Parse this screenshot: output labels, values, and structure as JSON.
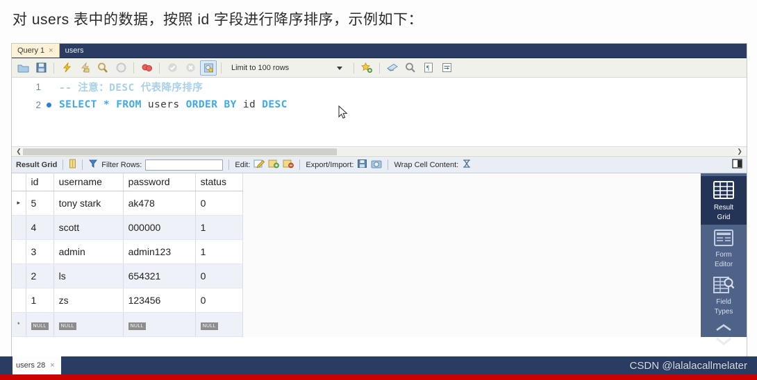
{
  "heading": "对 users 表中的数据，按照 id 字段进行降序排序，示例如下：",
  "tabs": {
    "query_tab": "Query 1",
    "query_tab_close": "×",
    "table_tab": "users"
  },
  "toolbar": {
    "icons": [
      "open-folder-icon",
      "save-icon",
      "execute-icon",
      "execute-current-icon",
      "explain-icon",
      "stop-on-error-icon",
      "toggle-query-icon",
      "commit-icon",
      "rollback-icon",
      "autocommit-icon"
    ],
    "limit_label": "Limit to 100 rows",
    "right_icons": [
      "beautify-icon",
      "find-icon",
      "search-icon",
      "toggle-invisible-icon",
      "wrap-lines-icon"
    ]
  },
  "editor": {
    "lines": [
      {
        "number": "1",
        "marker": "",
        "comment": "-- 注意：DESC 代表降序排序"
      },
      {
        "number": "2",
        "marker": "dot",
        "kw1": "SELECT",
        "star": "*",
        "kw2": "FROM",
        "table": "users",
        "kw3": "ORDER BY",
        "column": "id",
        "kw4": "DESC"
      }
    ]
  },
  "gridbar": {
    "result_grid_label": "Result Grid",
    "grid_icon": "grid-toggle-icon",
    "filter_icon": "filter-icon",
    "filter_rows_label": "Filter Rows:",
    "filter_value": "",
    "filter_placeholder": "",
    "edit_label": "Edit:",
    "edit_icons": [
      "edit-pencil-icon",
      "insert-row-icon",
      "delete-row-icon"
    ],
    "export_label": "Export/Import:",
    "export_icons": [
      "export-icon",
      "import-icon"
    ],
    "wrap_label": "Wrap Cell Content:",
    "wrap_icon": "wrap-cell-icon",
    "panel_toggle_icon": "panel-toggle-icon"
  },
  "grid": {
    "columns": [
      "id",
      "username",
      "password",
      "status"
    ],
    "rows": [
      {
        "marker": "▸",
        "id": "5",
        "username": "tony stark",
        "password": "ak478",
        "status": "0"
      },
      {
        "marker": "",
        "id": "4",
        "username": "scott",
        "password": "000000",
        "status": "1"
      },
      {
        "marker": "",
        "id": "3",
        "username": "admin",
        "password": "admin123",
        "status": "1"
      },
      {
        "marker": "",
        "id": "2",
        "username": "ls",
        "password": "654321",
        "status": "0"
      },
      {
        "marker": "",
        "id": "1",
        "username": "zs",
        "password": "123456",
        "status": "0"
      }
    ],
    "new_row": {
      "marker": "*",
      "id": "NULL",
      "username": "NULL",
      "password": "NULL",
      "status": "NULL"
    }
  },
  "sidebar": {
    "items": [
      {
        "label_line1": "Result",
        "label_line2": "Grid",
        "icon": "result-grid-icon",
        "active": true
      },
      {
        "label_line1": "Form",
        "label_line2": "Editor",
        "icon": "form-editor-icon",
        "active": false
      },
      {
        "label_line1": "Field",
        "label_line2": "Types",
        "icon": "field-types-icon",
        "active": false
      }
    ],
    "chevron_up": "chevron-up-icon",
    "chevron_down": "chevron-down-icon"
  },
  "statusbar": {
    "tab_label": "users 28",
    "tab_close": "×"
  },
  "watermark": "CSDN @lalalacallmelater",
  "colors": {
    "tab_navy": "#2a3c62",
    "active_tab": "#fdf2d7",
    "keyword_blue": "#3fa9e8",
    "comment_blue": "#a9d1e6",
    "sidebar_blue": "#4f6287",
    "sidebar_active": "#243457",
    "row_alt": "#eef1f8",
    "red_bar": "#cc0000"
  }
}
